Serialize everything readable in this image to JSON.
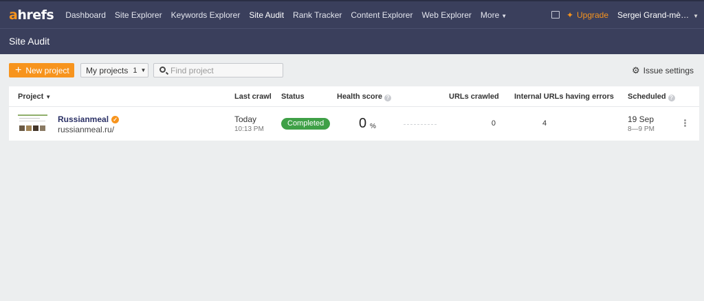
{
  "logo": {
    "brand": "ahrefs"
  },
  "nav": {
    "items": [
      "Dashboard",
      "Site Explorer",
      "Keywords Explorer",
      "Site Audit",
      "Rank Tracker",
      "Content Explorer",
      "Web Explorer"
    ],
    "active": "Site Audit",
    "more_label": "More"
  },
  "topbar": {
    "upgrade_label": "Upgrade",
    "user_name": "Sergei Grand-mè…"
  },
  "page": {
    "title": "Site Audit"
  },
  "toolbar": {
    "new_project_label": "New project",
    "my_projects_label": "My projects",
    "my_projects_count": "1",
    "search_placeholder": "Find project",
    "issue_settings_label": "Issue settings"
  },
  "table": {
    "headers": {
      "project": "Project",
      "last_crawl": "Last crawl",
      "status": "Status",
      "health_score": "Health score",
      "urls_crawled": "URLs crawled",
      "internal_errors": "Internal URLs having errors",
      "scheduled": "Scheduled"
    },
    "rows": [
      {
        "name": "Russianmeal",
        "url": "russianmeal.ru/",
        "last_crawl_day": "Today",
        "last_crawl_time": "10:13 PM",
        "status": "Completed",
        "health_score": "0",
        "health_unit": "%",
        "urls_crawled": "0",
        "internal_errors": "4",
        "scheduled_date": "19 Sep",
        "scheduled_time": "8—9 PM"
      }
    ]
  },
  "colors": {
    "accent": "#f7941d",
    "header_bg": "#3a3f5c",
    "status_completed": "#3fa047"
  },
  "icons": [
    "monitor-icon",
    "sparkle-icon",
    "plus-icon",
    "search-icon",
    "gear-icon",
    "help-icon",
    "verified-icon",
    "kebab-menu-icon"
  ]
}
